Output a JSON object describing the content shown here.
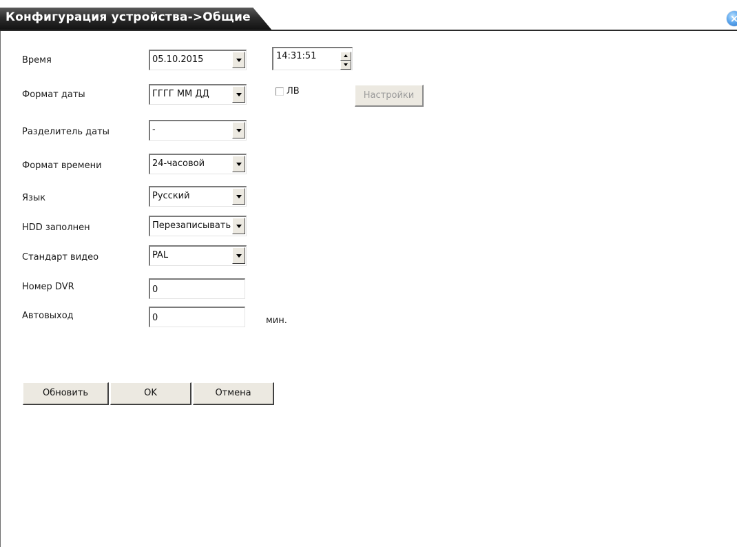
{
  "window": {
    "title": "Конфигурация устройства->Общие",
    "close_symbol": "×"
  },
  "form": {
    "time": {
      "label": "Время",
      "date_value": "05.10.2015",
      "time_value": "14:31:51"
    },
    "date_format": {
      "label": "Формат даты",
      "value": "ГГГГ ММ ДД",
      "dst_label": "ЛВ",
      "dst_checked": false,
      "settings_button": "Настройки",
      "settings_enabled": false
    },
    "date_separator": {
      "label": "Разделитель даты",
      "value": "-"
    },
    "time_format": {
      "label": "Формат времени",
      "value": "24-часовой"
    },
    "language": {
      "label": "Язык",
      "value": "Русский"
    },
    "hdd_full": {
      "label": "HDD заполнен",
      "value": "Перезаписывать"
    },
    "video_standard": {
      "label": "Стандарт видео",
      "value": "PAL"
    },
    "dvr_number": {
      "label": "Номер DVR",
      "value": "0"
    },
    "auto_logout": {
      "label": "Автовыход",
      "value": "0",
      "unit": "мин."
    }
  },
  "buttons": {
    "refresh": "Обновить",
    "ok": "OK",
    "cancel": "Отмена"
  },
  "colors": {
    "title_bar": "#1f1f1f",
    "close_button": "#3f8fdf",
    "button_face": "#ece9e1"
  }
}
